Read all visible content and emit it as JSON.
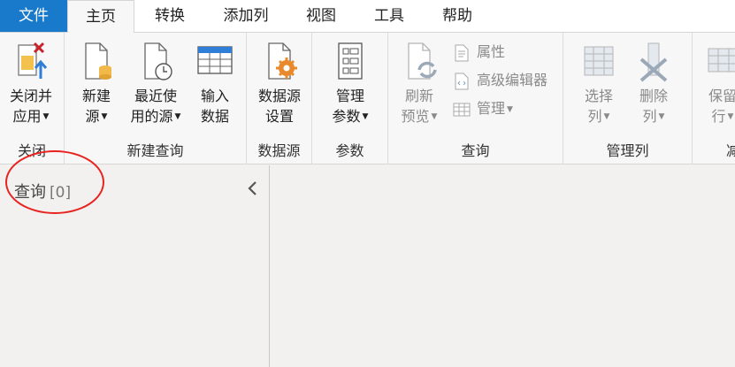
{
  "tabs": [
    "文件",
    "主页",
    "转换",
    "添加列",
    "视图",
    "工具",
    "帮助"
  ],
  "groups": {
    "close": {
      "label": "关闭",
      "buttons": [
        {
          "line1": "关闭并",
          "line2": "应用",
          "dropdown": true
        }
      ]
    },
    "new_query": {
      "label": "新建查询",
      "buttons": [
        {
          "line1": "新建",
          "line2": "源",
          "dropdown": true
        },
        {
          "line1": "最近使",
          "line2": "用的源",
          "dropdown": true
        },
        {
          "line1": "输入",
          "line2": "数据",
          "dropdown": false
        }
      ]
    },
    "data_source": {
      "label": "数据源",
      "buttons": [
        {
          "line1": "数据源",
          "line2": "设置",
          "dropdown": false
        }
      ]
    },
    "parameters": {
      "label": "参数",
      "buttons": [
        {
          "line1": "管理",
          "line2": "参数",
          "dropdown": true
        }
      ]
    },
    "query": {
      "label": "查询",
      "refresh": {
        "line1": "刷新",
        "line2": "预览",
        "dropdown": true
      },
      "small": [
        "属性",
        "高级编辑器",
        "管理"
      ]
    },
    "manage_columns": {
      "label": "管理列",
      "buttons": [
        {
          "line1": "选择",
          "line2": "列",
          "dropdown": true
        },
        {
          "line1": "删除",
          "line2": "列",
          "dropdown": true
        }
      ]
    },
    "reduce_rows": {
      "label": "减",
      "buttons": [
        {
          "line1": "保留",
          "line2": "行",
          "dropdown": true
        }
      ]
    }
  },
  "query_pane": {
    "title": "查询",
    "count": "[0]"
  },
  "colors": {
    "accent": "#1979ca",
    "annotation": "#e8231f",
    "icon_orange": "#e8892b"
  }
}
